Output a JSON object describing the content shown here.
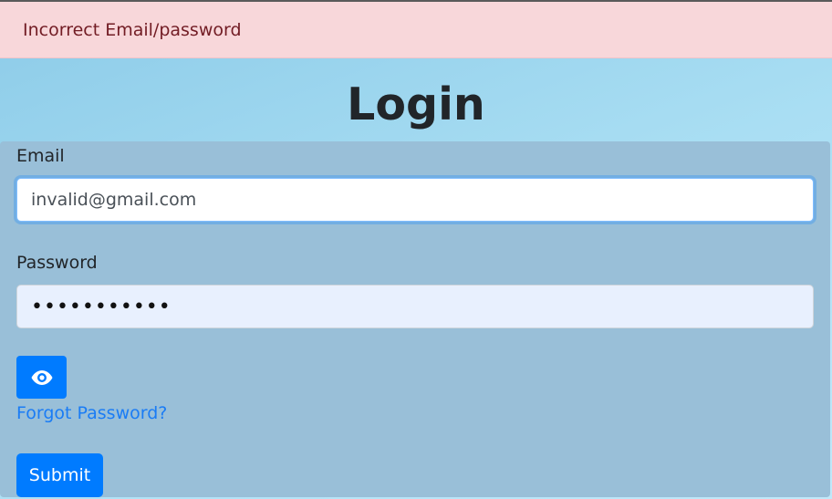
{
  "alert": {
    "message": "Incorrect Email/password",
    "background_color": "#f8d7da",
    "text_color": "#721c24"
  },
  "page": {
    "title": "Login"
  },
  "form": {
    "email_label": "Email",
    "email_value": "invalid@gmail.com",
    "password_label": "Password",
    "password_value": "•••••••••••",
    "toggle_icon": "eye-icon",
    "forgot_password_link": "Forgot Password?",
    "submit_label": "Submit"
  },
  "colors": {
    "accent": "#007bff",
    "panel": "#99bfd8",
    "link": "#1a7cf5"
  }
}
